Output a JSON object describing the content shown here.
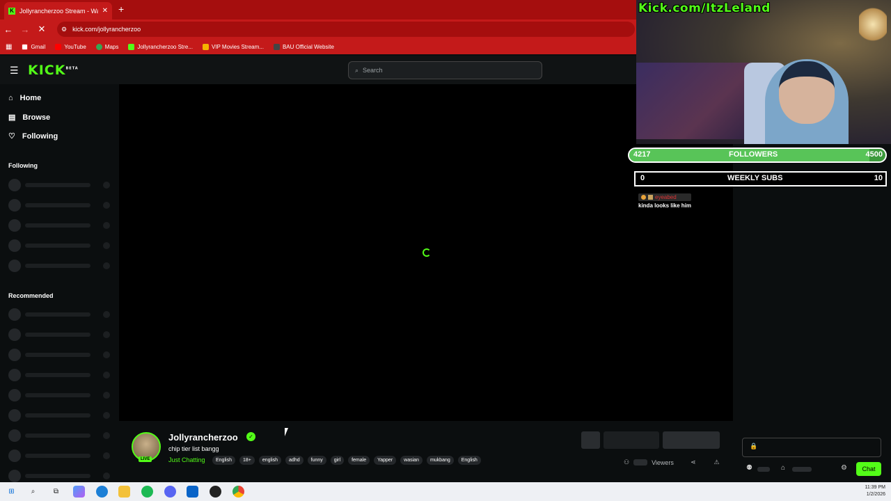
{
  "browser": {
    "tab_title": "Jollyrancherzoo Stream - Watch",
    "url": "kick.com/jollyrancherzoo",
    "bookmarks": [
      "Gmail",
      "YouTube",
      "Maps",
      "Jollyrancherzoo Stre...",
      "VIP Movies Stream...",
      "BAU Official Website"
    ]
  },
  "site": {
    "logo": "KICK",
    "logo_beta": "BETA",
    "search_placeholder": "Search"
  },
  "sidebar": {
    "nav": [
      "Home",
      "Browse",
      "Following"
    ],
    "following_label": "Following",
    "recommended_label": "Recommended"
  },
  "stream": {
    "streamer": "Jollyrancherzoo",
    "title": "chip tier list bangg",
    "category": "Just Chatting",
    "live_badge": "LIVE",
    "tags": [
      "English",
      "18+",
      "english",
      "adhd",
      "funny",
      "girl",
      "female",
      "Yapper",
      "wasian",
      "mukbang",
      "English"
    ],
    "viewers_label": "Viewers"
  },
  "chat": {
    "chat_button": "Chat"
  },
  "overlay": {
    "cam_text": "Kick.com/ItzLeland",
    "followers": {
      "current": "4217",
      "label": "FOLLOWERS",
      "goal": "4500",
      "progress": 0.937
    },
    "subs": {
      "current": "0",
      "label": "WEEKLY SUBS",
      "goal": "10"
    },
    "chat_user": "eyeabed",
    "chat_message": "kinda looks like him"
  },
  "taskbar": {
    "time": "11:39 PM",
    "date": "1/2/2026"
  }
}
